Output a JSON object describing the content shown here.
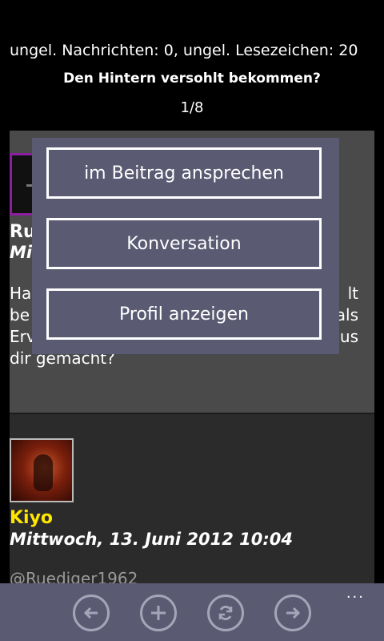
{
  "header": {
    "status": "ungel. Nachrichten: 0, ungel. Lesezeichen: 20",
    "thread_title": "Den Hintern versohlt bekommen?",
    "pager": "1/8"
  },
  "posts": [
    {
      "author": "Ru",
      "date": "Mi",
      "body_lines_left": [
        "Ha",
        "be",
        "Erv",
        "dir gemacht?"
      ],
      "body_lines_right": [
        "lt",
        "als",
        "aus"
      ]
    },
    {
      "author": "Kiyo",
      "date": "Mittwoch, 13. Juni 2012 10:04",
      "body": "@Ruediger1962"
    }
  ],
  "context_menu": {
    "items": [
      "im Beitrag ansprechen",
      "Konversation",
      "Profil anzeigen"
    ]
  },
  "appbar": {
    "buttons": [
      "back-icon",
      "add-icon",
      "refresh-icon",
      "forward-icon"
    ],
    "more": "..."
  },
  "colors": {
    "menu_bg": "#5a5a73",
    "author_highlight": "#ffe600",
    "avatar_border": "#8b1fa0"
  }
}
